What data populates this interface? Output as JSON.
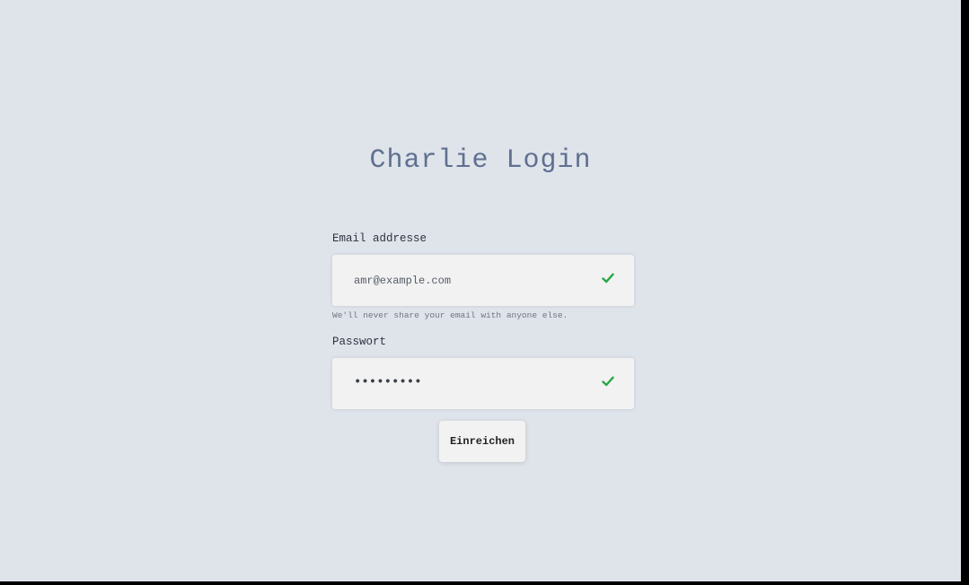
{
  "page": {
    "title": "Charlie Login"
  },
  "form": {
    "email": {
      "label": "Email addresse",
      "value": "amr@example.com",
      "help": "We'll never share your email with anyone else.",
      "valid_icon": "check-icon"
    },
    "password": {
      "label": "Passwort",
      "masked_value": "•••••••••",
      "valid_icon": "check-icon"
    },
    "submit_label": "Einreichen"
  },
  "colors": {
    "background": "#dfe4eb",
    "title": "#5f7090",
    "field_bg": "#f2f2f2",
    "valid": "#28a745"
  }
}
